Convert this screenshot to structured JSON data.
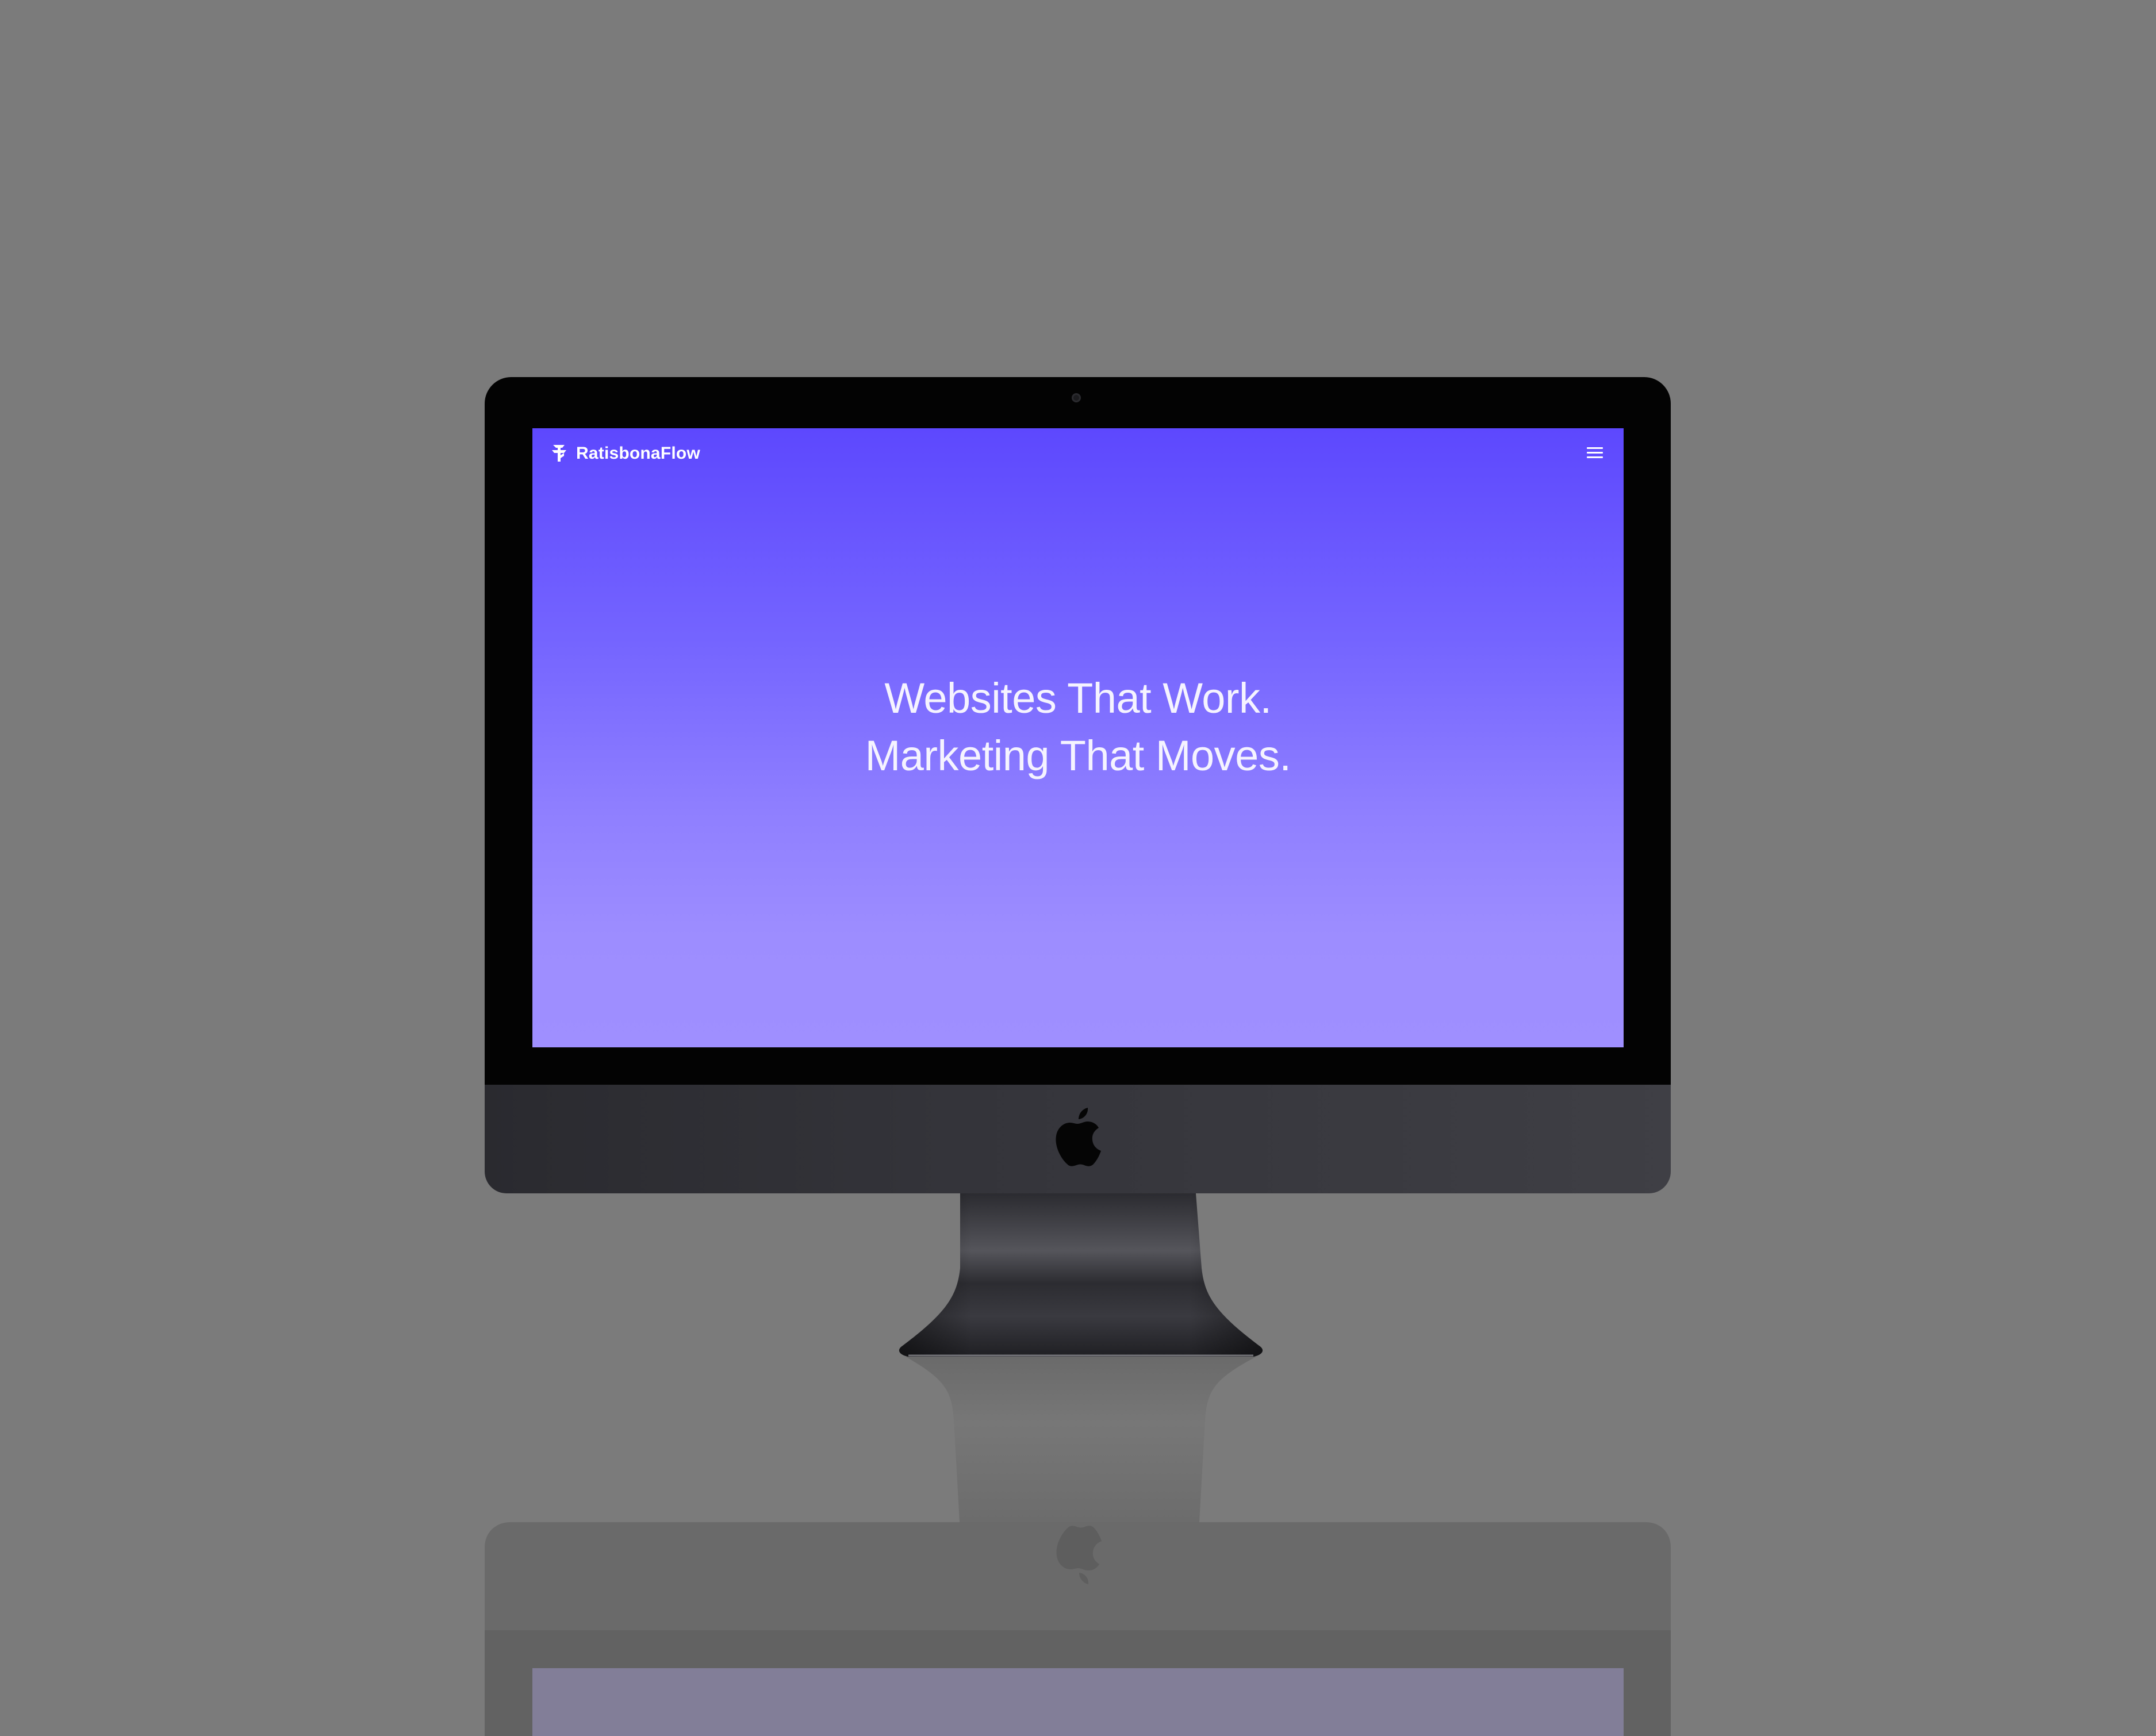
{
  "site": {
    "brand": "RatisbonaFlow",
    "logo_icon": "ratisbonaflow-logo-icon",
    "menu_icon": "hamburger-menu-icon",
    "hero": {
      "line1": "Websites That Work.",
      "line2": "Marketing That Moves."
    }
  },
  "device": {
    "type": "iMac",
    "brand_icon": "apple-logo-icon"
  },
  "colors": {
    "background": "#7b7b7b",
    "gradient_top": "#5d48fe",
    "gradient_bottom": "#9f8fff",
    "bezel": "#030303",
    "chin": "#35353b",
    "text": "#ffffff"
  }
}
